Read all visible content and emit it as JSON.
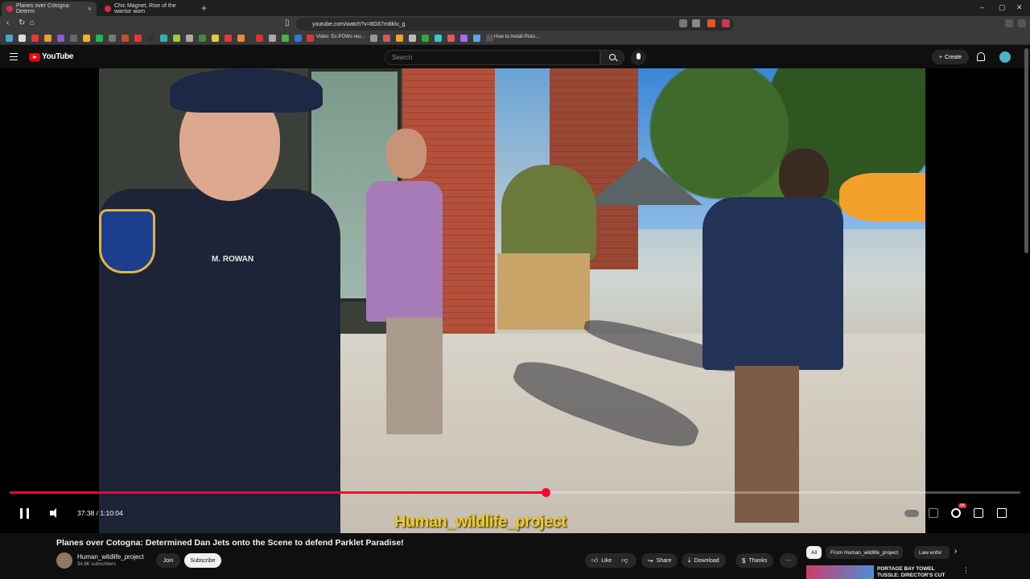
{
  "browser": {
    "tabs": [
      {
        "label": "Planes over Cotogna: Determ",
        "active": true
      },
      {
        "label": "Chic Magnet, Rise of the warrior wom",
        "active": false
      }
    ],
    "url": "youtube.com/watch?v=8G67m8klu_g",
    "bookmarks": [
      {
        "label": "Video: Ex-POWs reu..."
      },
      {
        "label": "How to install Pluto..."
      }
    ],
    "window_controls": [
      "–",
      "▢",
      "✕"
    ]
  },
  "youtube": {
    "logo_text": "YouTube",
    "search_placeholder": "Search",
    "create_label": "Create",
    "icons": {
      "menu": "hamburger-icon",
      "search": "search-icon",
      "mic": "mic-icon",
      "bell": "bell-icon"
    }
  },
  "player": {
    "caption": "Human_wildlife_project",
    "time_current": "37:38",
    "time_total": "1:10:04",
    "progress_fraction": 0.53,
    "officer_name": "M. ROWAN",
    "quality_badge": "4K",
    "colors": {
      "progress": "#ff0033",
      "caption": "#f7ce16"
    }
  },
  "video": {
    "title": "Planes over Cotogna: Determined Dan Jets onto the Scene to defend Parklet Paradise!",
    "channel": "Human_wildlife_project",
    "subscribers": "34.6K subscribers",
    "join_label": "Join",
    "subscribe_label": "Subscribe",
    "actions": [
      {
        "label": "Like",
        "icon": "thumbs-up-icon"
      },
      {
        "label": "Share",
        "icon": "share-icon"
      },
      {
        "label": "Download",
        "icon": "download-icon"
      },
      {
        "label": "Thanks",
        "icon": "thanks-icon"
      }
    ]
  },
  "related": {
    "chips": [
      {
        "label": "All",
        "active": true
      },
      {
        "label": "From Human_wildlife_project",
        "active": false
      },
      {
        "label": "Law enfor",
        "active": false
      }
    ],
    "first_item_title": "PORTAGE BAY TOWEL TUSSLE: DIRECTOR'S CUT EDITION"
  }
}
